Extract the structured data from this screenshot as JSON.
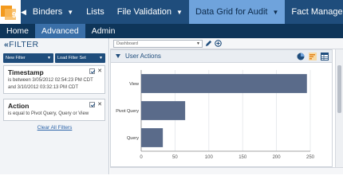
{
  "app": {
    "logo_text": "9"
  },
  "topnav": {
    "items": [
      {
        "label": "Binders"
      },
      {
        "label": "Lists"
      },
      {
        "label": "File Validation"
      },
      {
        "label": "Data Grid for Audit"
      },
      {
        "label": "Fact Manager"
      }
    ]
  },
  "subnav": {
    "items": [
      {
        "label": "Home"
      },
      {
        "label": "Advanced"
      },
      {
        "label": "Admin"
      }
    ]
  },
  "filter_panel": {
    "collapse_glyph": "«",
    "title": "FILTER",
    "new_filter_label": "New Filter",
    "load_filter_set_label": "Load Filter Set",
    "filters": [
      {
        "title": "Timestamp",
        "description": "is between 3/05/2012 02:54:23 PM CDT and 3/10/2012 03:32:13 PM CDT"
      },
      {
        "title": "Action",
        "description": "is equal to Pivot Query, Query or View"
      }
    ],
    "clear_all_label": "Clear All Filters"
  },
  "toolbar": {
    "dashboard_placeholder": "Dashboard"
  },
  "widget": {
    "title": "User Actions"
  },
  "colors": {
    "nav_bg": "#1f4d7c",
    "subnav_bg": "#0e3559",
    "active_tab": "#6fa3dc",
    "bar_fill": "#5a6b8a",
    "logo_orange": "#f39a1e"
  },
  "chart_data": {
    "type": "bar",
    "orientation": "horizontal",
    "categories": [
      "View",
      "Pivot Query",
      "Query"
    ],
    "values": [
      245,
      65,
      32
    ],
    "xlim": [
      0,
      250
    ],
    "x_ticks": [
      0,
      50,
      100,
      150,
      200,
      250
    ],
    "grid": true
  }
}
